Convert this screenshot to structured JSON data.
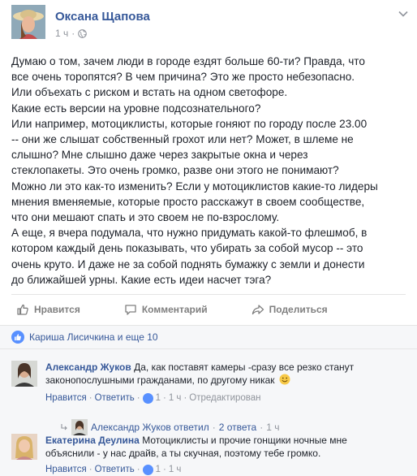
{
  "post": {
    "author": "Оксана Щапова",
    "time": "1 ч",
    "lines": [
      "Думаю о том, зачем люди в городе ездят больше 60-ти? Правда, что",
      "все очень торопятся? В чем причина? Это же просто небезопасно.",
      "Или объехать с риском и встать на одном светофоре.",
      "Какие есть версии на уровне подсознательного?",
      "Или например, мотоциклисты, которые гоняют по городу после 23.00",
      "-- они же слышат собственный грохот или нет? Может, в шлеме не",
      "слышно? Мне слышно даже через закрытые окна и через",
      "стеклопакеты. Это очень громко, разве они этого не понимают?",
      "Можно ли это как-то изменить? Если у мотоциклистов какие-то лидеры",
      "мнения вменяемые, которые просто расскажут в своем сообществе,",
      "что они мешают спать и это своем не по-взрослому.",
      "А еще, я вчера подумала, что нужно придумать какой-то флешмоб, в",
      "котором каждый день показывать, что убирать за собой мусор -- это",
      "очень круто. И даже не за собой поднять бумажку с земли и донести",
      "до ближайшей урны. Какие есть идеи насчет тэга?"
    ]
  },
  "actions": {
    "like": "Нравится",
    "comment": "Комментарий",
    "share": "Поделиться"
  },
  "reactions": {
    "text": "Кариша Лисичкина и еще 10"
  },
  "comments": [
    {
      "name": "Александр Жуков",
      "line1": "Да, как поставят камеры -сразу все резко станут",
      "line2": "законопослушными гражданами, по другому никак",
      "like": "Нравится",
      "reply": "Ответить",
      "likes": "1",
      "time": "1 ч",
      "edited": "Отредактирован",
      "reply_summary": "Александр Жуков ответил",
      "reply_count": "2 ответа",
      "reply_time": "1 ч"
    },
    {
      "name": "Екатерина Деулина",
      "line1": "Мотоциклисты и прочие гонщики ночные мне",
      "line2": "объяснили - у нас драйв, а ты скучная, поэтому тебе громко.",
      "like": "Нравится",
      "reply": "Ответить",
      "likes": "1",
      "time": "1 ч"
    }
  ],
  "icons": {
    "globe": "globe-icon",
    "menu": "chevron-down-icon",
    "like": "thumbs-up-icon",
    "comment": "speech-bubble-icon",
    "share": "share-arrow-icon"
  },
  "colors": {
    "link": "#365899",
    "meta": "#90949c",
    "like_blue": "#5890ff",
    "panel": "#f6f7f9"
  }
}
